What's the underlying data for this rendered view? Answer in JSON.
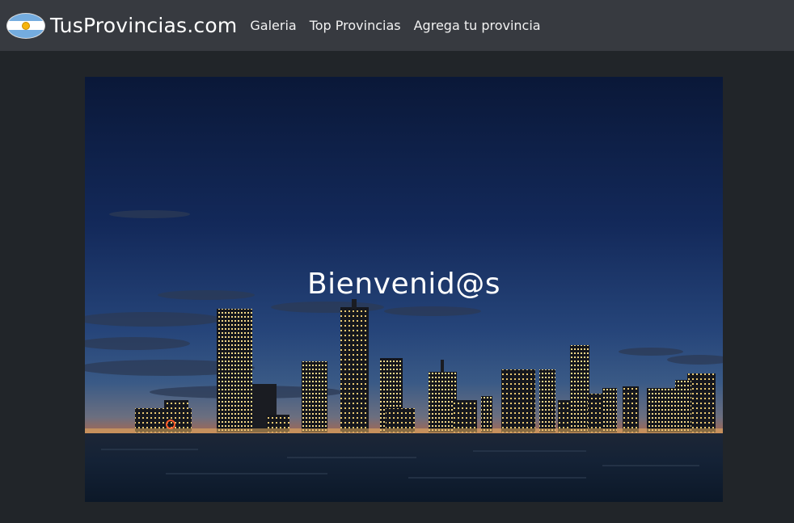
{
  "navbar": {
    "brand": "TusProvincias.com",
    "flag_icon": "argentina-flag-icon",
    "links": [
      "Galeria",
      "Top Provincias",
      "Agrega tu provincia"
    ]
  },
  "hero": {
    "title": "Bienvenid@s",
    "image": "city-skyline-at-dusk-image"
  },
  "colors": {
    "navbar_bg": "#373a40",
    "page_bg": "#212529",
    "text": "#ffffff"
  }
}
